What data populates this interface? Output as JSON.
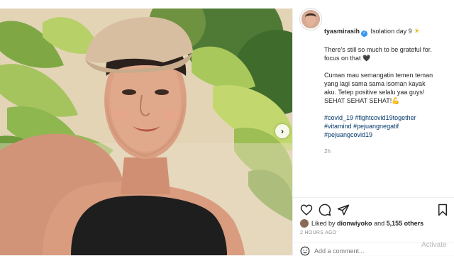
{
  "post": {
    "username": "tyasmirasih",
    "location": "Isolation day 9",
    "caption_line1": "There's still so much to be grateful for.",
    "caption_line2": "focus on that",
    "body_lines": [
      "Cuman mau semangatin temen teman",
      "yang lagi sama sama isoman kayak",
      "aku. Tetep positive selalu yaa guys!",
      "SEHAT SEHAT SEHAT!"
    ],
    "hashtags": [
      "#covid_19 #fightcovid19together",
      "#vitamind #pejuangnegatif",
      "#pejuangcovid19"
    ],
    "caption_time": "2h",
    "liked_by_prefix": "Liked by",
    "liked_by_user": "dionwiyoko",
    "liked_by_and": "and",
    "liked_by_others": "5,155 others",
    "time_ago": "2 HOURS AGO",
    "comment_placeholder": "Add a comment...",
    "watermark": "Activate"
  },
  "icons": {
    "verified": "verified-badge-icon",
    "sun": "sun-emoji-icon",
    "heart_emoji": "black-heart-emoji-icon",
    "flex": "flexed-arm-emoji-icon",
    "like": "heart-icon",
    "comment": "comment-icon",
    "share": "paper-plane-icon",
    "save": "bookmark-icon",
    "next": "chevron-right-icon",
    "emoji": "emoji-icon"
  },
  "colors": {
    "accent_link": "#00376b",
    "verified_blue": "#3897f0",
    "muted_text": "#8e8e8e",
    "border": "#efefef"
  }
}
